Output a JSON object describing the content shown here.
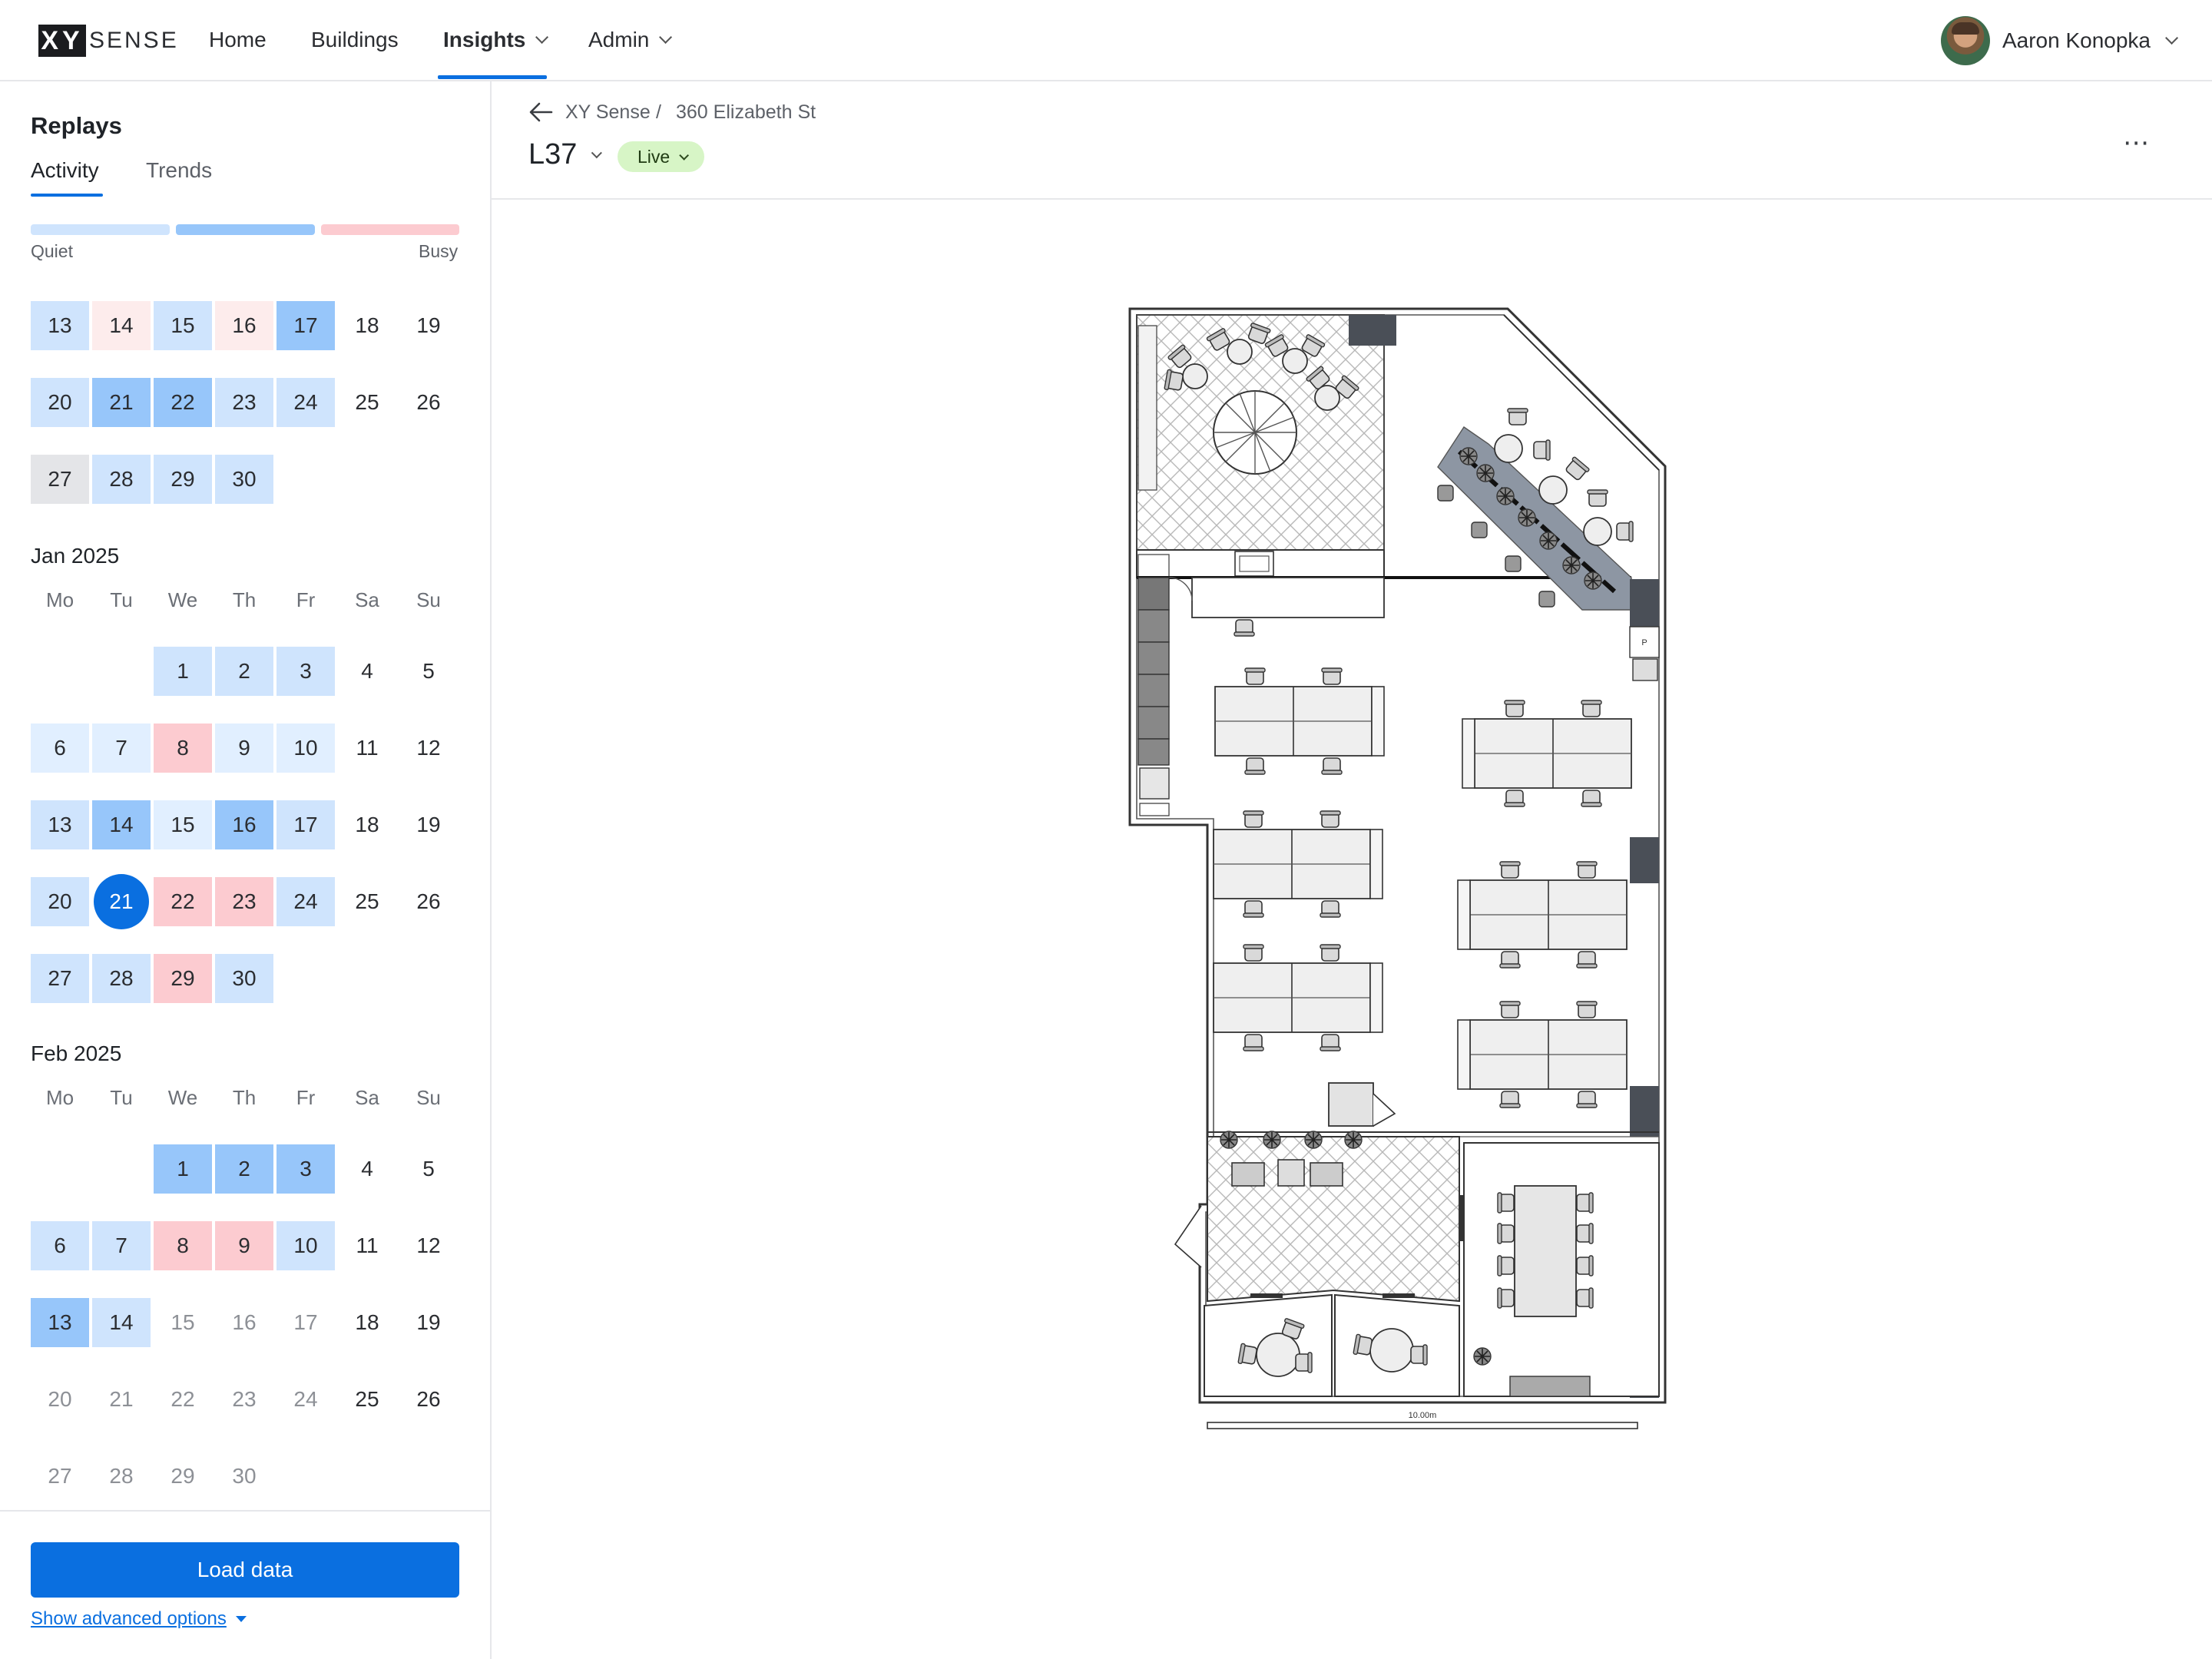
{
  "nav": {
    "logo_mark": "XY",
    "logo_text": "SENSE",
    "items": [
      {
        "label": "Home"
      },
      {
        "label": "Buildings"
      },
      {
        "label": "Insights"
      },
      {
        "label": "Admin"
      }
    ],
    "active": "Insights",
    "user_name": "Aaron Konopka"
  },
  "sidebar": {
    "title": "Replays",
    "tabs": [
      "Activity",
      "Trends"
    ],
    "active_tab": "Activity",
    "legend": {
      "quiet": "Quiet",
      "busy": "Busy",
      "colors": [
        "#cfe4fd",
        "#97c6fa",
        "#fccbd0"
      ]
    },
    "weekdays": [
      "Mo",
      "Tu",
      "We",
      "Th",
      "Fr",
      "Sa",
      "Su"
    ],
    "prev_month_rows": [
      [
        [
          "13",
          "l2"
        ],
        [
          "14",
          "p1"
        ],
        [
          "15",
          "l2"
        ],
        [
          "16",
          "p1"
        ],
        [
          "17",
          "l3"
        ],
        [
          "18",
          ""
        ],
        [
          "19",
          ""
        ]
      ],
      [
        [
          "20",
          "l2"
        ],
        [
          "21",
          "l3"
        ],
        [
          "22",
          "l3"
        ],
        [
          "23",
          "l2"
        ],
        [
          "24",
          "l2"
        ],
        [
          "25",
          ""
        ],
        [
          "26",
          ""
        ]
      ],
      [
        [
          "27",
          "gray"
        ],
        [
          "28",
          "l2"
        ],
        [
          "29",
          "l2"
        ],
        [
          "30",
          "l2"
        ],
        null,
        null,
        null
      ]
    ],
    "months": [
      {
        "title": "Jan 2025",
        "rows": [
          [
            null,
            null,
            [
              "1",
              "l2"
            ],
            [
              "2",
              "l2"
            ],
            [
              "3",
              "l2"
            ],
            [
              "4",
              ""
            ],
            [
              "5",
              ""
            ]
          ],
          [
            [
              "6",
              "l1"
            ],
            [
              "7",
              "l1"
            ],
            [
              "8",
              "p2"
            ],
            [
              "9",
              "l1"
            ],
            [
              "10",
              "l1"
            ],
            [
              "11",
              ""
            ],
            [
              "12",
              ""
            ]
          ],
          [
            [
              "13",
              "l2"
            ],
            [
              "14",
              "l3"
            ],
            [
              "15",
              "l1"
            ],
            [
              "16",
              "l3"
            ],
            [
              "17",
              "l2"
            ],
            [
              "18",
              ""
            ],
            [
              "19",
              ""
            ]
          ],
          [
            [
              "20",
              "l2"
            ],
            [
              "21",
              "sel"
            ],
            [
              "22",
              "p2"
            ],
            [
              "23",
              "p2"
            ],
            [
              "24",
              "l2"
            ],
            [
              "25",
              ""
            ],
            [
              "26",
              ""
            ]
          ],
          [
            [
              "27",
              "l2"
            ],
            [
              "28",
              "l2"
            ],
            [
              "29",
              "p2"
            ],
            [
              "30",
              "l2"
            ],
            null,
            null,
            null
          ]
        ]
      },
      {
        "title": "Feb 2025",
        "rows": [
          [
            null,
            null,
            [
              "1",
              "l3"
            ],
            [
              "2",
              "l3"
            ],
            [
              "3",
              "l3"
            ],
            [
              "4",
              ""
            ],
            [
              "5",
              ""
            ]
          ],
          [
            [
              "6",
              "l2"
            ],
            [
              "7",
              "l2"
            ],
            [
              "8",
              "p2"
            ],
            [
              "9",
              "p2"
            ],
            [
              "10",
              "l2"
            ],
            [
              "11",
              ""
            ],
            [
              "12",
              ""
            ]
          ],
          [
            [
              "13",
              "l3"
            ],
            [
              "14",
              "l2"
            ],
            [
              "15",
              "dim"
            ],
            [
              "16",
              "dim"
            ],
            [
              "17",
              "dim"
            ],
            [
              "18",
              ""
            ],
            [
              "19",
              ""
            ]
          ],
          [
            [
              "20",
              "dim"
            ],
            [
              "21",
              "dim"
            ],
            [
              "22",
              "dim"
            ],
            [
              "23",
              "dim"
            ],
            [
              "24",
              "dim"
            ],
            [
              "25",
              ""
            ],
            [
              "26",
              ""
            ]
          ],
          [
            [
              "27",
              "dim"
            ],
            [
              "28",
              "dim"
            ],
            [
              "29",
              "dim"
            ],
            [
              "30",
              "dim"
            ],
            null,
            null,
            null
          ]
        ]
      }
    ],
    "load_button": "Load data",
    "advanced_link": "Show advanced options"
  },
  "header": {
    "breadcrumb": [
      "XY Sense",
      "360 Elizabeth St"
    ],
    "breadcrumb_sep": "/",
    "floor": "L37",
    "status": "Live",
    "status_color": "#d7f5c6",
    "more_icon": "⋯"
  },
  "floorplan": {
    "scale_label": "10.00m",
    "sign_label": "P"
  }
}
